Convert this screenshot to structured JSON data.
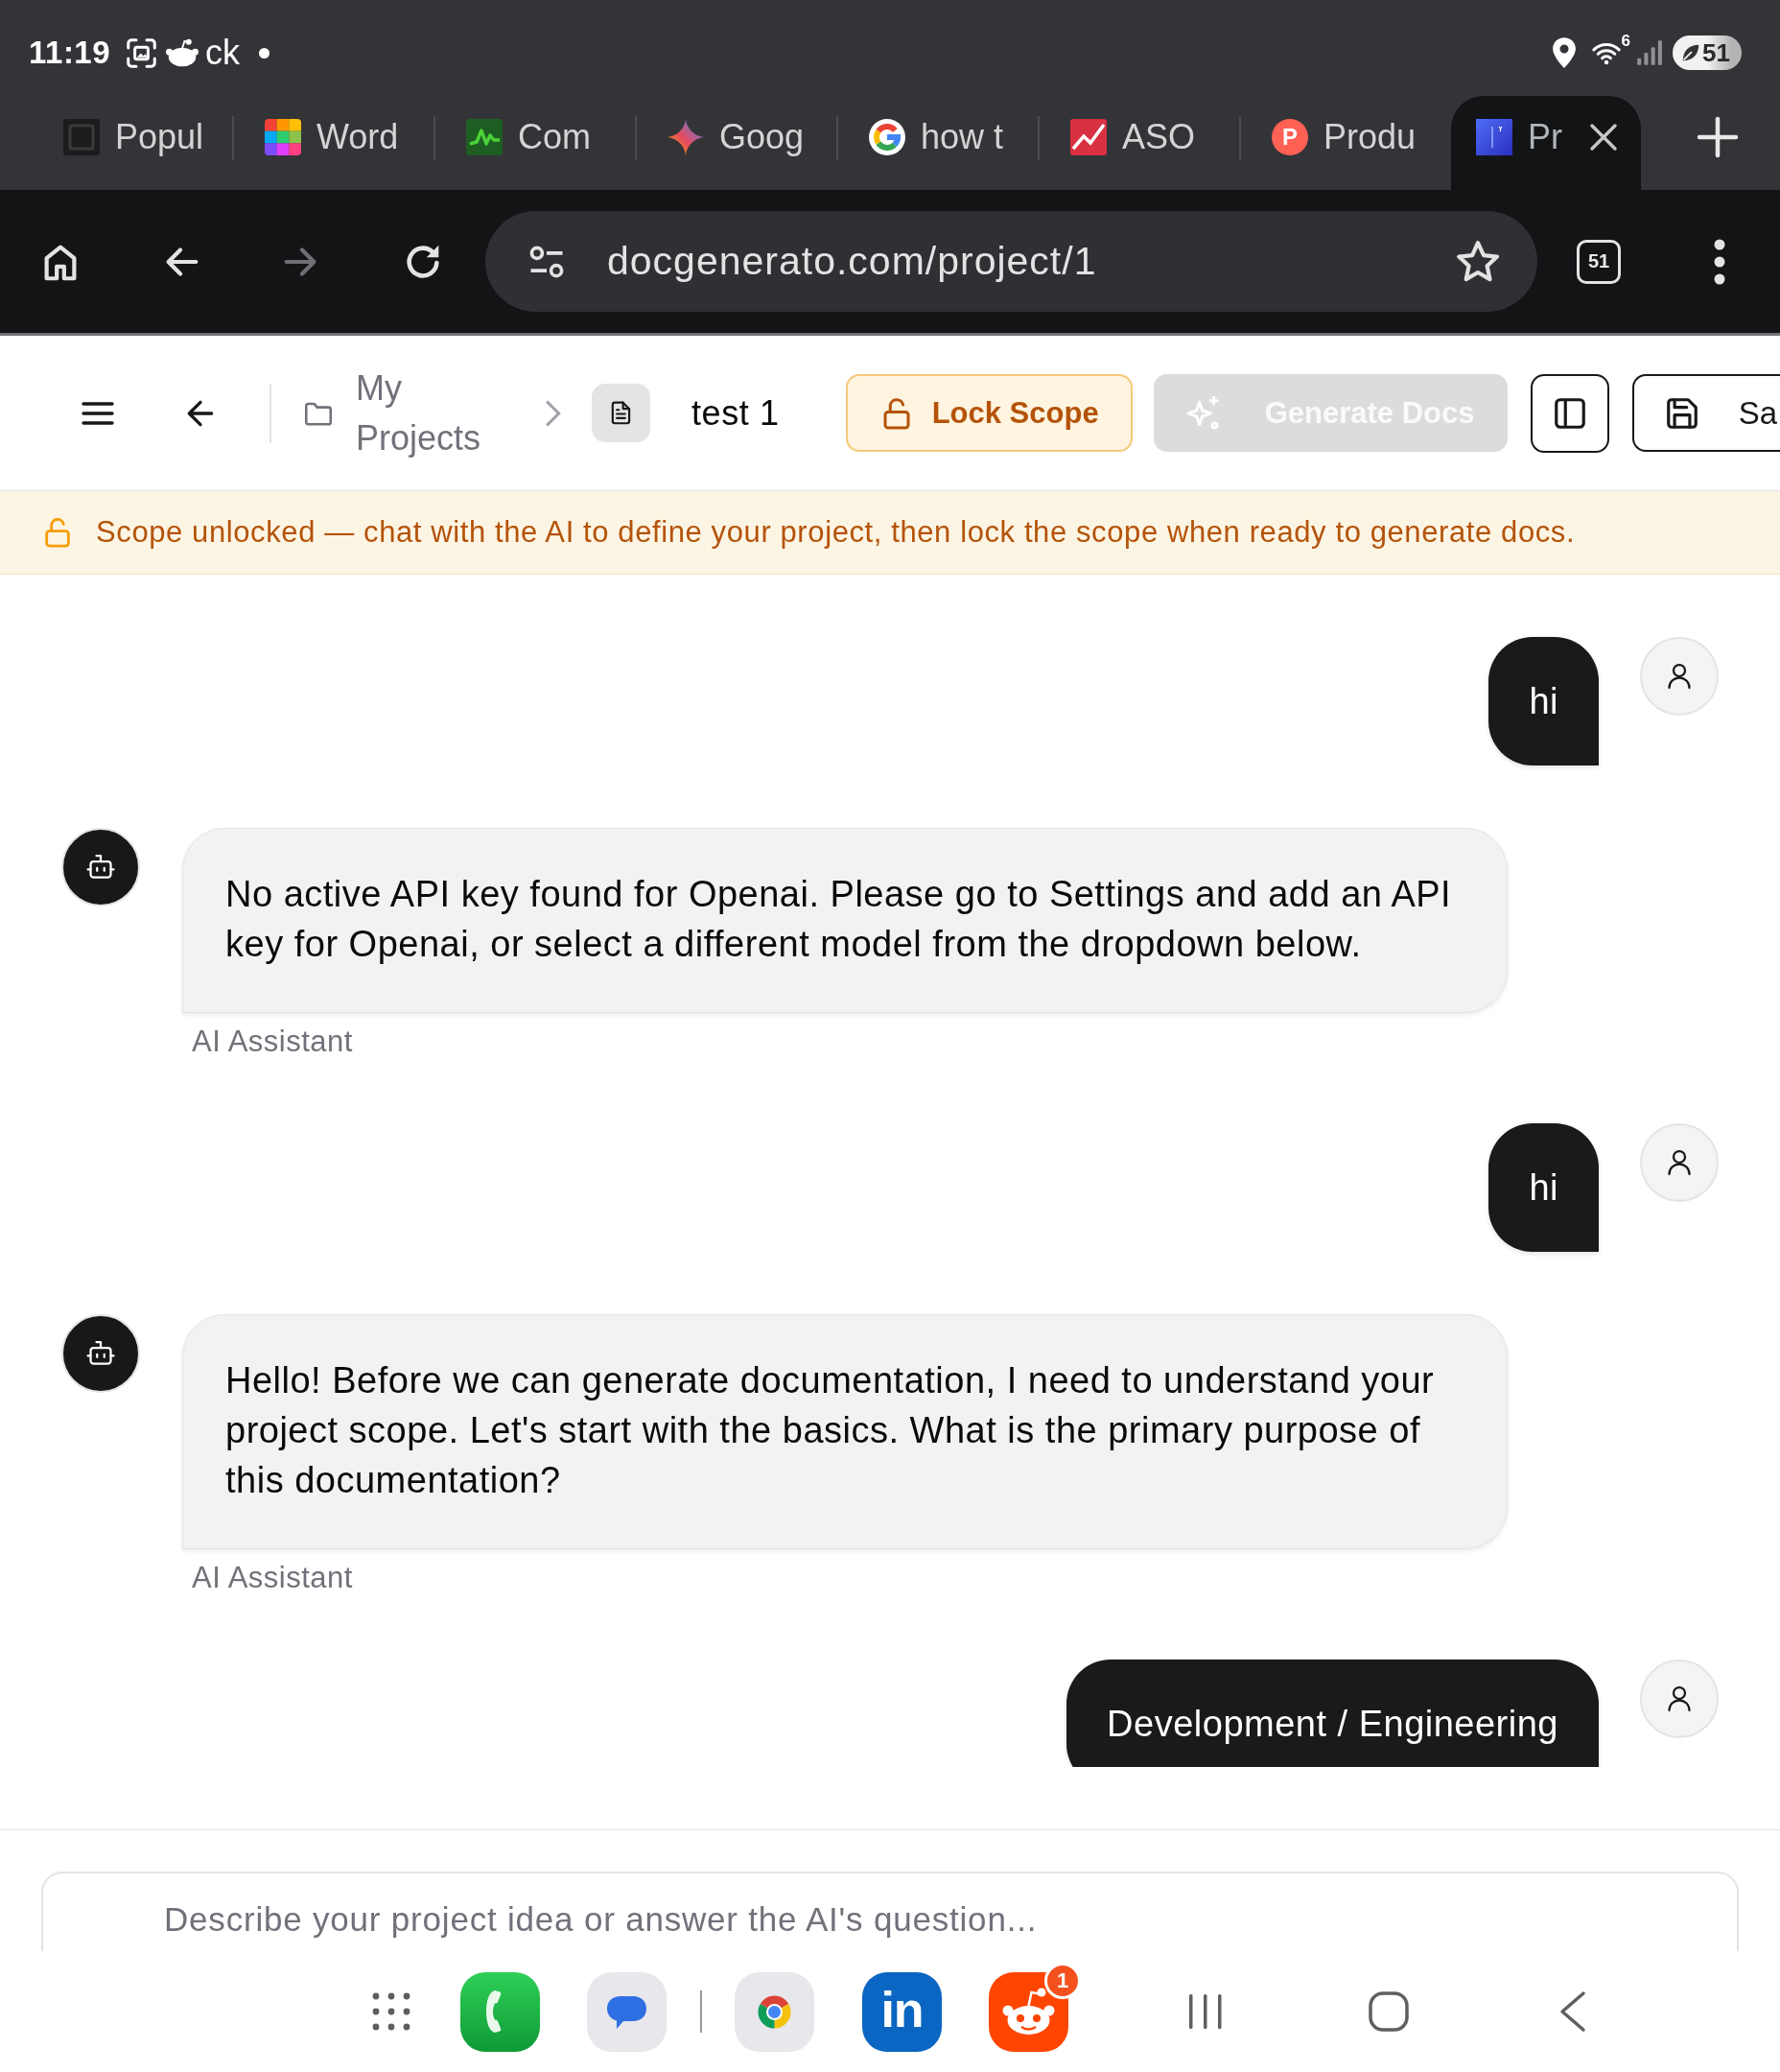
{
  "status_bar": {
    "time": "11:19",
    "notification_text": "ck",
    "wifi_badge": "6",
    "battery": "51"
  },
  "browser": {
    "tabs": [
      {
        "title": "Popul",
        "kind": "square",
        "selected": false
      },
      {
        "title": "Word",
        "kind": "grid",
        "selected": false
      },
      {
        "title": "Com",
        "kind": "chart",
        "selected": false
      },
      {
        "title": "Goog",
        "kind": "star",
        "selected": false
      },
      {
        "title": "how t",
        "kind": "ring",
        "selected": false
      },
      {
        "title": "ASO",
        "kind": "trend",
        "selected": false
      },
      {
        "title": "Produ",
        "kind": "letter",
        "favicon_letter": "P",
        "selected": false
      },
      {
        "title": "Pr",
        "kind": "tile",
        "selected": true
      }
    ],
    "url": "docgenerato.com/project/1",
    "tab_count": "51"
  },
  "header": {
    "breadcrumb": "My Projects",
    "project_name": "test 1",
    "actions": [
      {
        "kind": "lock",
        "label": "Lock Scope",
        "disabled": false
      },
      {
        "kind": "generate",
        "label": "Generate Docs",
        "disabled": true
      },
      {
        "kind": "panel",
        "disabled": false
      },
      {
        "kind": "save",
        "label": "Sa",
        "disabled": false
      }
    ]
  },
  "banner": {
    "locked": false,
    "text": "Scope unlocked — chat with the AI to define your project, then lock the scope when ready to generate docs."
  },
  "messages": [
    {
      "kind": "user",
      "text": "hi"
    },
    {
      "kind": "assistant",
      "text": "No active API key found for Openai. Please go to Settings and add an API key for Openai, or select a different model from the dropdown below.",
      "sender": "AI Assistant"
    },
    {
      "kind": "user",
      "text": "hi"
    },
    {
      "kind": "assistant",
      "text": "Hello! Before we can generate documentation, I need to understand your project scope. Let's start with the basics. What is the primary purpose of this documentation?",
      "sender": "AI Assistant"
    },
    {
      "kind": "user",
      "text": "Development / Engineering"
    }
  ],
  "composer": {
    "placeholder": "Describe your project idea or answer the AI's question..."
  },
  "dock": {
    "apps": [
      {
        "kind": "phone"
      },
      {
        "kind": "messages"
      },
      {
        "kind": "browser"
      },
      {
        "kind": "linkedin",
        "label": "in"
      },
      {
        "kind": "reddit",
        "badge": "1"
      }
    ]
  }
}
